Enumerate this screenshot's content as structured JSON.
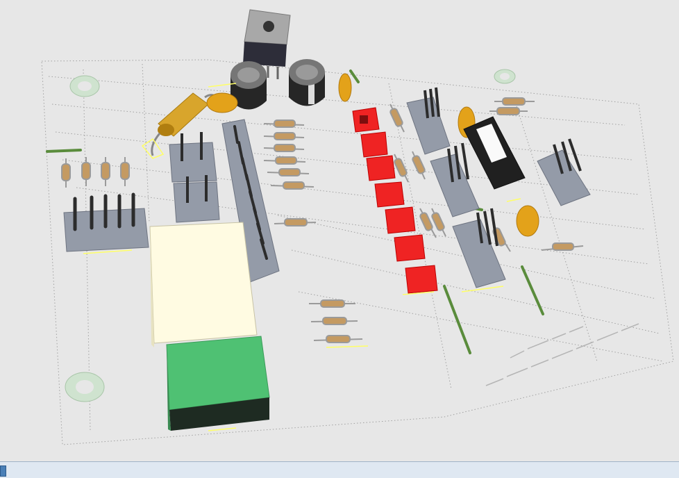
{
  "window": {
    "title": ""
  },
  "board": {
    "colors": {
      "background": "#e7e7e7",
      "silkscreen": "#ffff66",
      "led": "#ef2323",
      "socket": "#949ba8",
      "pin": "#2c2c2c",
      "resistor_body": "#c49a62",
      "trimmer_cap": "#e3a21a",
      "electrolytic_cap": "#3d3d3d",
      "connector_large": "#fffbe2",
      "connector_green": "#4fc173",
      "jumper_wire": "#5a8c3c",
      "ic_body": "#202020"
    },
    "components": [
      {
        "name": "regulator",
        "kind": "TO-220"
      },
      {
        "name": "electrolytic-cap-1",
        "kind": "capacitor"
      },
      {
        "name": "electrolytic-cap-2",
        "kind": "capacitor"
      },
      {
        "name": "tantalum-cap",
        "kind": "capacitor"
      },
      {
        "name": "ceramic-caps",
        "kind": "capacitor"
      },
      {
        "name": "led-array",
        "kind": "led",
        "count": 7
      },
      {
        "name": "resistor-array",
        "kind": "resistor"
      },
      {
        "name": "pin-headers",
        "kind": "header"
      },
      {
        "name": "dip-socket",
        "kind": "ic"
      },
      {
        "name": "usb-connector",
        "kind": "connector"
      },
      {
        "name": "terminal-block",
        "kind": "connector"
      }
    ]
  },
  "statusbar": {
    "text": ""
  }
}
